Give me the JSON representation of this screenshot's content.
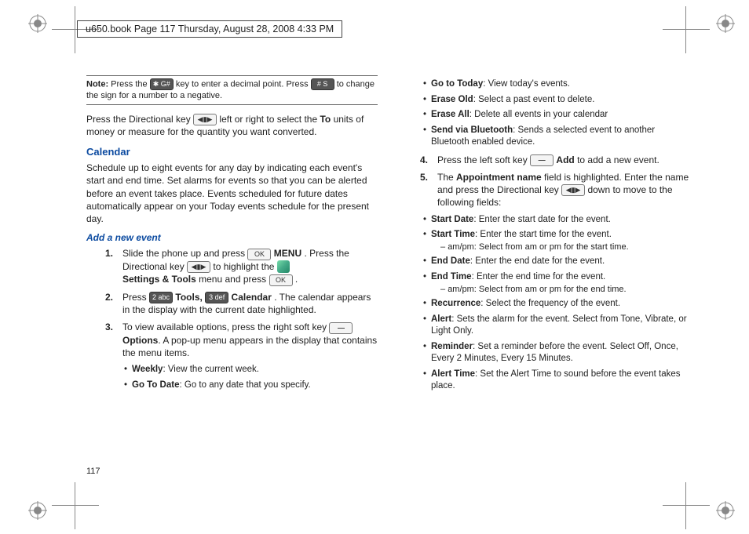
{
  "header": "u650.book  Page 117  Thursday, August 28, 2008  4:33 PM",
  "page_number": "117",
  "note": {
    "label": "Note:",
    "text_a": "Press the ",
    "key1": "✱ G#",
    "text_b": " key to enter a decimal point. Press ",
    "key2": "# S",
    "text_c": " to change the sign for a number to a negative."
  },
  "intro": {
    "a": "Press the Directional key ",
    "b": " left or right to select the ",
    "to": "To",
    "c": " units of money or measure for the quantity you want converted."
  },
  "calendar": {
    "title": "Calendar",
    "desc": "Schedule up to eight events for any day by indicating each event's start and end time. Set alarms for events so that you can be alerted before an event takes place. Events scheduled for future dates automatically appear on your Today events schedule for the present day.",
    "add_title": "Add a new event",
    "steps": {
      "s1_a": "Slide the phone up and press ",
      "s1_ok": "OK",
      "s1_b": " ",
      "s1_menu": "MENU",
      "s1_c": ". Press the Directional key ",
      "s1_d": " to highlight the ",
      "s1_st": "Settings & Tools",
      "s1_e": " menu and press ",
      "s1_f": ".",
      "s2_a": "Press ",
      "s2_k1": "2 abc",
      "s2_tools": "Tools,",
      "s2_k2": "3 def",
      "s2_cal": "Calendar",
      "s2_b": ". The calendar appears in the display with the current date highlighted.",
      "s3_a": "To view available options, press the right soft key ",
      "s3_opt": "Options",
      "s3_b": ". A pop-up menu appears in the display that contains the menu items."
    },
    "bul1": {
      "weekly_l": "Weekly",
      "weekly_t": ": View the current week.",
      "gotod_l": "Go To Date",
      "gotod_t": ": Go to any date that you specify.",
      "gotot_l": "Go to Today",
      "gotot_t": ": View today's events.",
      "eraseo_l": "Erase Old",
      "eraseo_t": ": Select a past event to delete.",
      "erasea_l": "Erase All",
      "erasea_t": ": Delete all events in your calendar",
      "sendbt_l": "Send via Bluetooth",
      "sendbt_t": ": Sends a selected event to another Bluetooth enabled device."
    },
    "s4_a": "Press the left soft key ",
    "s4_add": "Add",
    "s4_b": " to add a new event.",
    "s5_a": "The ",
    "s5_an": "Appointment name",
    "s5_b": " field is highlighted. Enter the name and press the Directional key ",
    "s5_c": " down to move to the following fields:",
    "bul2": {
      "sd_l": "Start Date",
      "sd_t": ": Enter the start date for the event.",
      "st_l": "Start Time",
      "st_t": ": Enter the start time for the event.",
      "st_s": "am/pm: Select from am or pm for the start time.",
      "ed_l": "End Date",
      "ed_t": ": Enter the end date for the event.",
      "et_l": "End Time",
      "et_t": ": Enter the end time for the event.",
      "et_s": "am/pm: Select from am or pm for the end time.",
      "rec_l": "Recurrence",
      "rec_t": ": Select the frequency of the event.",
      "al_l": "Alert",
      "al_t": ": Sets the alarm for the event. Select from Tone, Vibrate, or Light Only.",
      "rem_l": "Reminder",
      "rem_t": ": Set a reminder before the event. Select Off, Once, Every 2 Minutes, Every 15 Minutes.",
      "at_l": "Alert Time",
      "at_t": ": Set the Alert Time to sound before the event takes place."
    }
  }
}
